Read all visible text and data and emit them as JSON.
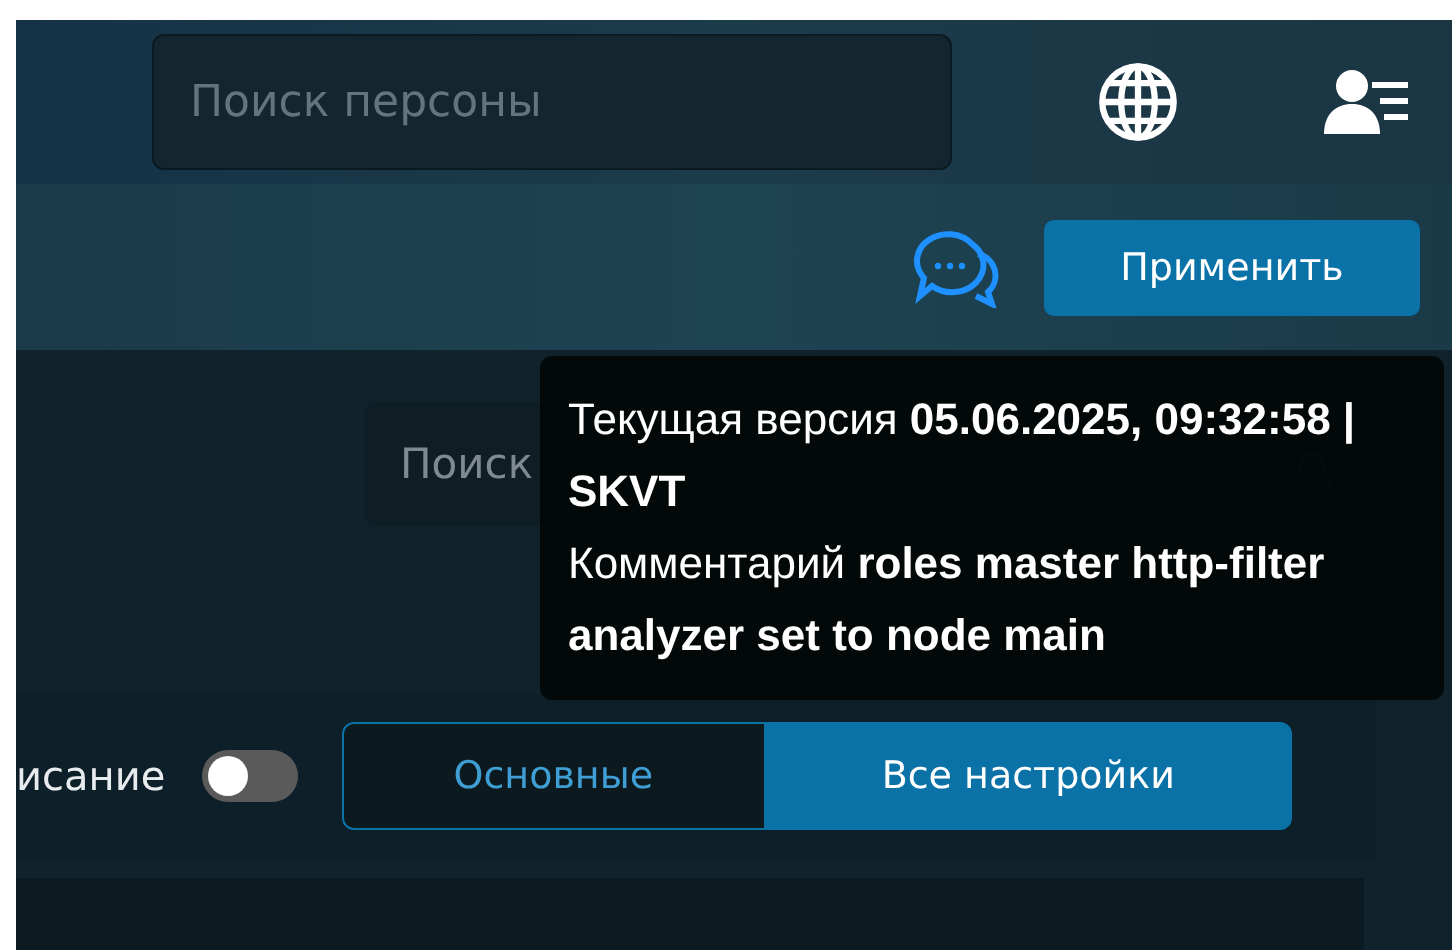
{
  "header": {
    "search": {
      "placeholder": "Поиск персоны"
    }
  },
  "toolbar": {
    "apply_button": "Применить"
  },
  "tooltip": {
    "lines": [
      "Текущая версия **05.06.2025, 09:32:58 | SKVT**",
      "Комментарий **roles master http-filter analyzer set to node main**"
    ]
  },
  "panel": {
    "search": {
      "placeholder": "Поиск"
    },
    "toggle": {
      "label": "исание",
      "on": false
    },
    "segments": [
      {
        "label": "Основные",
        "selected": false
      },
      {
        "label": "Все настройки",
        "selected": true
      }
    ]
  }
}
